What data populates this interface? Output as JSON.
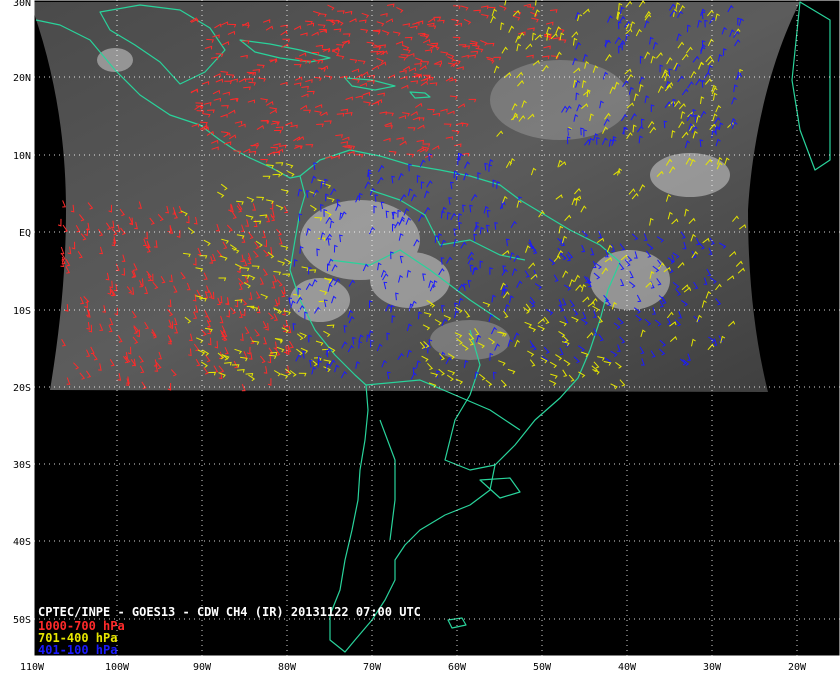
{
  "title": "CPTEC/INPE - GOES13 - CDW CH4 (IR) 20131122 07:00 UTC",
  "legend": [
    {
      "label": "1000-700 hPa",
      "color": "#ff2a2a"
    },
    {
      "label": "701-400 hPa",
      "color": "#e6e600"
    },
    {
      "label": "401-100 hPa",
      "color": "#1a1aff"
    }
  ],
  "x_ticks": [
    "110W",
    "100W",
    "90W",
    "80W",
    "70W",
    "60W",
    "50W",
    "40W",
    "30W",
    "20W"
  ],
  "y_ticks": [
    "30N",
    "20N",
    "10N",
    "EQ",
    "10S",
    "20S",
    "30S",
    "40S",
    "50S"
  ],
  "colors": {
    "space": "#000000",
    "coastline": "#29d39b",
    "frame": "#ffffff",
    "grid": "#ffffff"
  }
}
